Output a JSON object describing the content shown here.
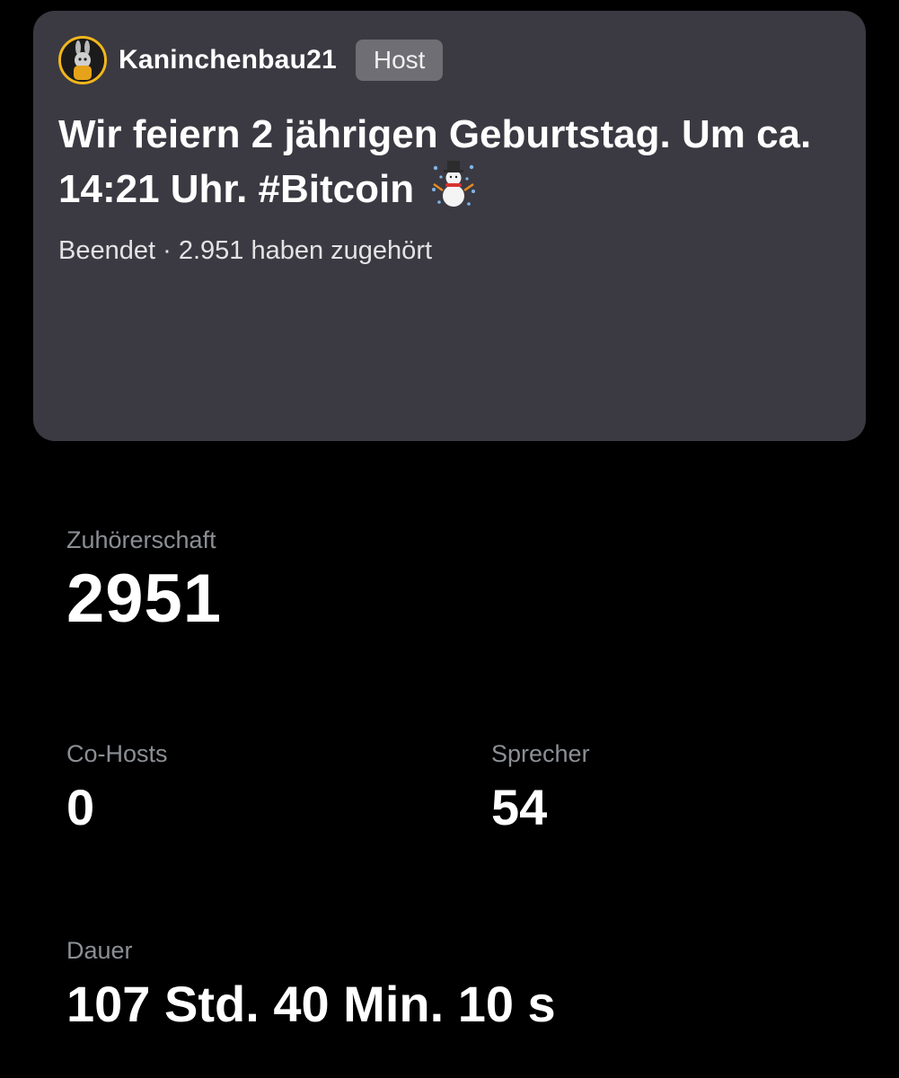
{
  "space": {
    "host": {
      "username": "Kaninchenbau21",
      "badge": "Host",
      "avatar_icon": "rabbit-astronaut-avatar"
    },
    "title": "Wir feiern 2 jährigen Geburtstag. Um ca. 14:21 Uhr. #Bitcoin",
    "title_emoji": "snowman-icon",
    "status": "Beendet",
    "separator": "·",
    "listeners_text": "2.951 haben zugehört"
  },
  "stats": {
    "audience": {
      "label": "Zuhörerschaft",
      "value": "2951"
    },
    "cohosts": {
      "label": "Co-Hosts",
      "value": "0"
    },
    "speakers": {
      "label": "Sprecher",
      "value": "54"
    },
    "duration": {
      "label": "Dauer",
      "value": "107 Std. 40 Min. 10 s"
    }
  },
  "colors": {
    "background": "#000000",
    "card": "#3b3a42",
    "badge": "#6f6e74",
    "label": "#8b8f94",
    "avatar_ring": "#f2b61c"
  }
}
